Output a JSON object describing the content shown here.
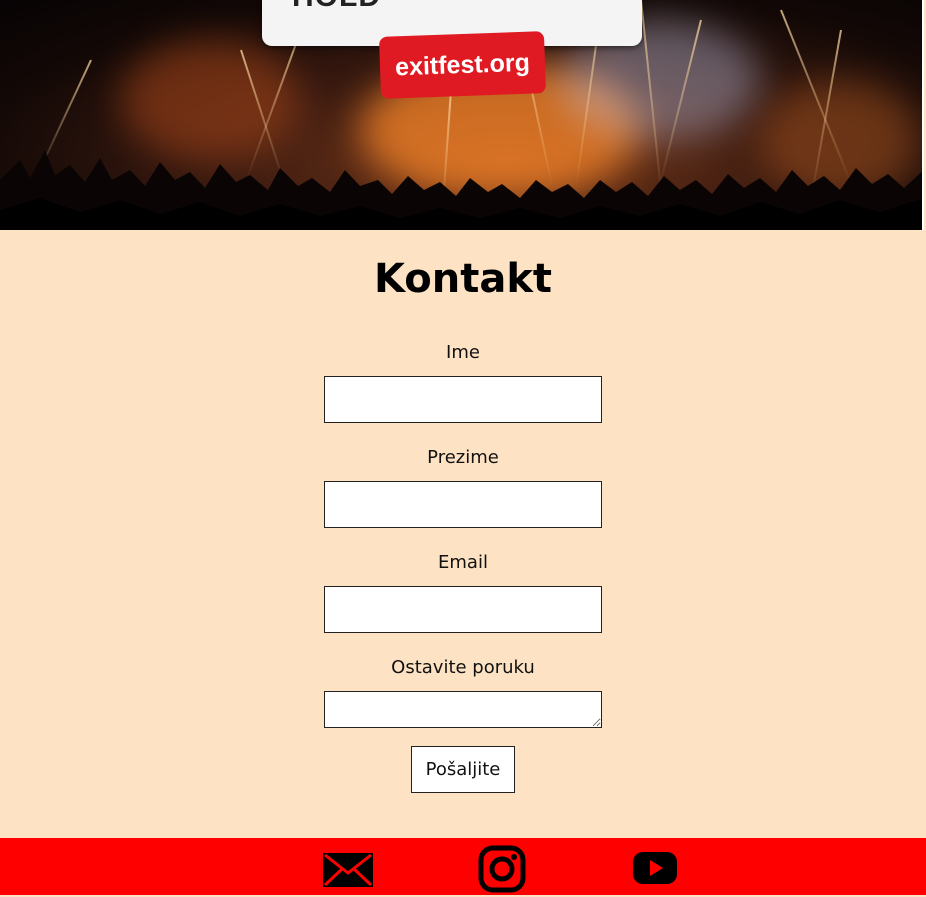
{
  "hero": {
    "banner_text": "HOLD",
    "site_tag": "exitfest.org"
  },
  "page": {
    "title": "Kontakt"
  },
  "form": {
    "first_name_label": "Ime",
    "last_name_label": "Prezime",
    "email_label": "Email",
    "message_label": "Ostavite poruku",
    "first_name_value": "",
    "last_name_value": "",
    "email_value": "",
    "message_value": "",
    "submit_label": "Pošaljite"
  },
  "footer": {
    "icons": [
      "mail-icon",
      "instagram-icon",
      "youtube-icon"
    ]
  },
  "colors": {
    "page_background": "#fde2c3",
    "footer_background": "#ff0000",
    "tag_background": "#e01a22"
  }
}
